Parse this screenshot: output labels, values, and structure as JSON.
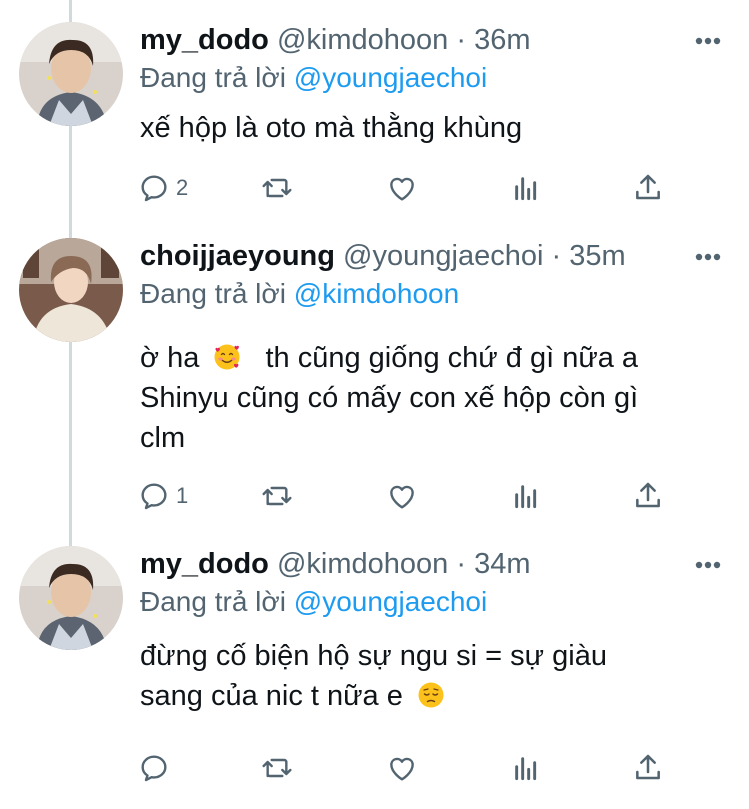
{
  "tweets": [
    {
      "name": "my_dodo",
      "handle": "@kimdohoon",
      "dot": "·",
      "time": "36m",
      "reply_prefix": "Đang trả lời",
      "reply_to": "@youngjaechoi",
      "lines": [
        "xế hộp là oto mà thằng khùng"
      ],
      "reply_count": "2"
    },
    {
      "name": "choijjaeyoung",
      "handle": "@youngjaechoi",
      "dot": "·",
      "time": "35m",
      "reply_prefix": "Đang trả lời",
      "reply_to": "@kimdohoon",
      "lines": [
        "ờ ha",
        "th cũng giống chứ đ gì nữa a",
        "Shinyu cũng có mấy con xế hộp còn gì",
        "clm"
      ],
      "emoji": "smiling-face-with-hearts",
      "reply_count": "1"
    },
    {
      "name": "my_dodo",
      "handle": "@kimdohoon",
      "dot": "·",
      "time": "34m",
      "reply_prefix": "Đang trả lời",
      "reply_to": "@youngjaechoi",
      "lines": [
        "đừng cố biện hộ sự ngu si = sự giàu",
        "sang của nic t nữa e"
      ],
      "emoji": "pensive-face",
      "reply_count": ""
    }
  ],
  "icons": {
    "reply": "reply-icon",
    "retweet": "retweet-icon",
    "like": "like-icon",
    "analytics": "analytics-icon",
    "share": "share-icon",
    "more": "more-icon"
  },
  "colors": {
    "mention": "#1d9bf0",
    "secondary_text": "#536471",
    "primary_text": "#0f1419",
    "thread_line": "#cfd9de"
  }
}
